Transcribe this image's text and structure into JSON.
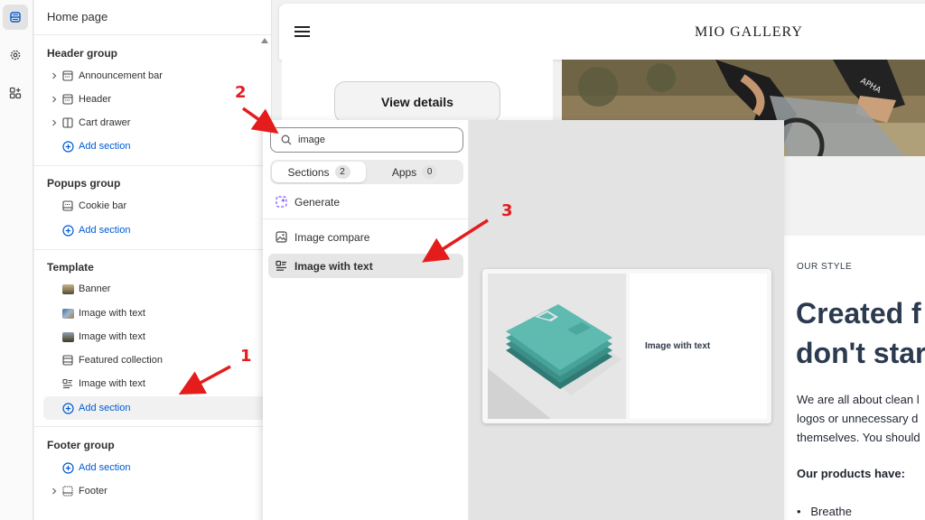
{
  "sidebar": {
    "title": "Home page",
    "groups": [
      {
        "title": "Header group",
        "items": [
          "Announcement bar",
          "Header",
          "Cart drawer"
        ],
        "add": "Add section"
      },
      {
        "title": "Popups group",
        "items": [
          "Cookie bar"
        ],
        "add": "Add section"
      },
      {
        "title": "Template",
        "items": [
          "Banner",
          "Image with text",
          "Image with text",
          "Featured collection",
          "Image with text"
        ],
        "add": "Add section"
      },
      {
        "title": "Footer group",
        "add": "Add section",
        "items": [
          "Footer"
        ]
      }
    ]
  },
  "preview": {
    "brand": "MIO GALLERY",
    "view_button": "View details",
    "eyebrow": "OUR STYLE",
    "headline": [
      "Created f",
      "don't star"
    ],
    "paragraph": [
      "We are all about clean l",
      "logos or unnecessary d",
      "themselves. You should"
    ],
    "products_heading": "Our products have:",
    "bullet": "Breathe"
  },
  "popover": {
    "search_value": "image",
    "tabs": [
      {
        "label": "Sections",
        "count": "2"
      },
      {
        "label": "Apps",
        "count": "0"
      }
    ],
    "generate_label": "Generate",
    "results": [
      "Image compare",
      "Image with text"
    ],
    "preview_label": "Image with text"
  },
  "annotations": [
    "1",
    "2",
    "3"
  ],
  "colors": {
    "link": "#005bd3",
    "annotation": "#e51c1c",
    "generate_accent": "#8051ff",
    "shirt": "#3fa39a"
  },
  "icons": [
    "sections-icon",
    "gear-icon",
    "apps-icon",
    "search-icon",
    "sparkle-icon",
    "hamburger-icon"
  ]
}
